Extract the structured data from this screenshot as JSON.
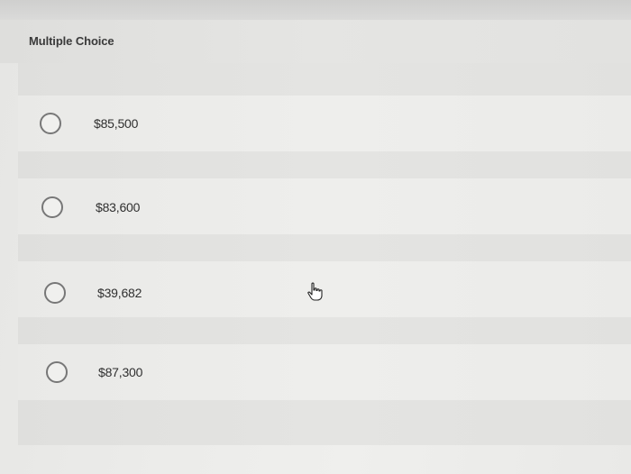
{
  "question": {
    "title": "Multiple Choice"
  },
  "options": [
    {
      "label": "$85,500",
      "selected": false
    },
    {
      "label": "$83,600",
      "selected": false
    },
    {
      "label": "$39,682",
      "selected": false
    },
    {
      "label": "$87,300",
      "selected": false
    }
  ],
  "cursor": {
    "icon": "hand-pointer-icon"
  }
}
